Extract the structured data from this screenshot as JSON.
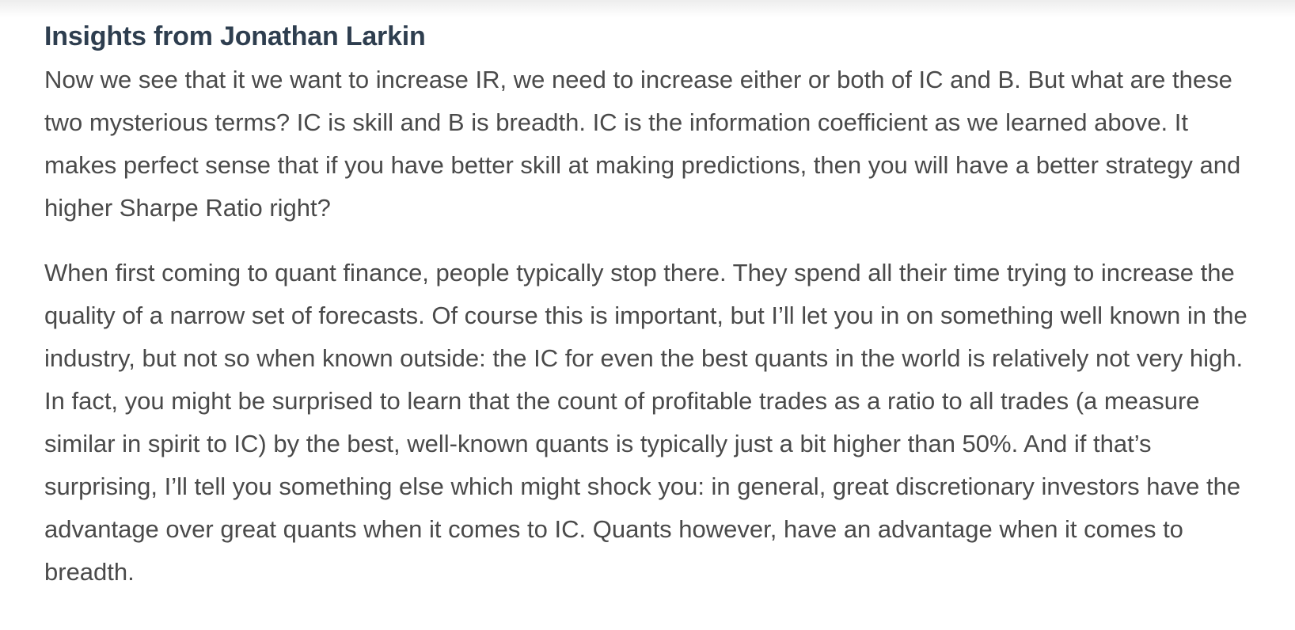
{
  "article": {
    "heading": "Insights from Jonathan Larkin",
    "paragraphs": [
      "Now we see that it we want to increase IR, we need to increase either or both of IC and B. But what are these two mysterious terms? IC is skill and B is breadth. IC is the information coefficient as we learned above. It makes perfect sense that if you have better skill at making predictions, then you will have a better strategy and higher Sharpe Ratio right?",
      "When first coming to quant finance, people typically stop there. They spend all their time trying to increase the quality of a narrow set of forecasts. Of course this is important, but I’ll let you in on something well known in the industry, but not so when known outside: the IC for even the best quants in the world is relatively not very high. In fact, you might be surprised to learn that the count of profitable trades as a ratio to all trades (a measure similar in spirit to IC) by the best, well-known quants is typically just a bit higher than 50%. And if that’s surprising, I’ll tell you something else which might shock you: in general, great discretionary investors have the advantage over great quants when it comes to IC. Quants however, have an advantage when it comes to breadth."
    ]
  }
}
